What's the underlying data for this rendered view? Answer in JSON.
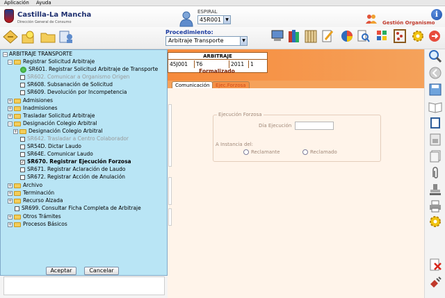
{
  "menu": {
    "items": [
      "Aplicación",
      "Ayuda"
    ]
  },
  "header": {
    "logo_title": "Castilla-La Mancha",
    "logo_subtitle": "Dirección General de Consumo",
    "espiral_label": "ESPIRAL",
    "espiral_value": "45R001",
    "org_label": "Gestión Organismo",
    "info_icon": "i"
  },
  "toolbar": {
    "procedure_label": "Procedimiento:",
    "procedure_value": "Arbitraje Transporte"
  },
  "record": {
    "heading": "ARBITRAJE",
    "cells": [
      "45J001",
      "T6",
      "2011",
      "1"
    ],
    "status": "Formalizado"
  },
  "tabs": [
    "Comunicación",
    "Ejec.Forzosa"
  ],
  "form": {
    "legend": "Ejecución Forzosa",
    "dia_label": "Día Ejecución",
    "dia_value": "",
    "instance_label": "A Instancia del:",
    "option_reclamante": "Reclamante",
    "option_reclamado": "Reclamado"
  },
  "tree": {
    "root": "ARBITRAJE TRANSPORTE",
    "registrar": "Registrar Solicitud Arbitraje",
    "sr601": "SR601. Registrar Solicitud Arbitraje de Transporte",
    "sr602": "SR602. Comunicar a Organismo Origen",
    "sr608": "SR608. Subsanación de Solicitud",
    "sr609": "SR609. Devolución por Incompetencia",
    "admisiones": "Admisiones",
    "inadmisiones": "Inadmisiones",
    "trasladar": "Trasladar Solicitud Arbitraje",
    "designacion": "Designación Colegio Arbitral",
    "designacion_sub": "Designación Colegio Arbitral",
    "sr642": "SR642. Trasladar a Centro Colaborador",
    "sr54d": "SR54D. Dictar Laudo",
    "sr64e": "SR64E. Comunicar Laudo",
    "sr670": "SR670. Registrar Ejecución Forzosa",
    "sr671": "SR671. Registrar Aclaración de Laudo",
    "sr672": "SR672. Registrar Acción de Anulación",
    "archivo": "Archivo",
    "terminacion": "Terminación",
    "recurso": "Recurso Alzada",
    "sr699": "SR699. Consultar Ficha Completa de Arbitraje",
    "otros": "Otros Trámites",
    "procesos": "Procesos Básicos"
  },
  "buttons": {
    "accept": "Aceptar",
    "cancel": "Cancelar"
  },
  "colors": {
    "accent_orange": "#f68a3b",
    "panel_blue": "#b9e5f5",
    "status_red": "#7a2000"
  }
}
